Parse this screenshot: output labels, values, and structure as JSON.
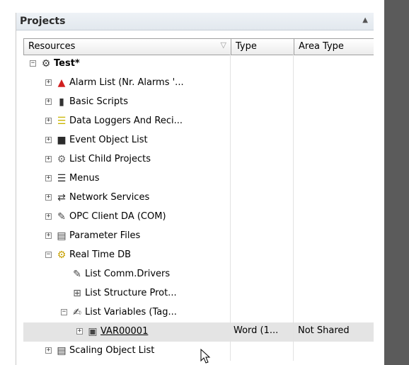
{
  "panel": {
    "title": "Projects"
  },
  "columns": {
    "resources": "Resources",
    "type": "Type",
    "area_type": "Area Type"
  },
  "tree": [
    {
      "label": "Test*",
      "expander": "−",
      "icon": "gear-icon",
      "glyph": "⚙",
      "color": "#3a3a3a",
      "type": "",
      "area": ""
    },
    {
      "label": "Alarm List (Nr. Alarms '...",
      "expander": "+",
      "icon": "alarm-bell-icon",
      "glyph": "▲",
      "color": "#d11f1f",
      "type": "",
      "area": ""
    },
    {
      "label": "Basic Scripts",
      "expander": "+",
      "icon": "script-icon",
      "glyph": "▮",
      "color": "#333333",
      "type": "",
      "area": ""
    },
    {
      "label": "Data Loggers And Reci...",
      "expander": "+",
      "icon": "database-icon",
      "glyph": "☰",
      "color": "#c9b400",
      "type": "",
      "area": ""
    },
    {
      "label": "Event Object List",
      "expander": "+",
      "icon": "event-icon",
      "glyph": "■",
      "color": "#2b2b2b",
      "type": "",
      "area": ""
    },
    {
      "label": "List Child Projects",
      "expander": "+",
      "icon": "child-projects-icon",
      "glyph": "⚙",
      "color": "#6a6a6a",
      "type": "",
      "area": ""
    },
    {
      "label": "Menus",
      "expander": "+",
      "icon": "menu-icon",
      "glyph": "☰",
      "color": "#2b2b2b",
      "type": "",
      "area": ""
    },
    {
      "label": "Network Services",
      "expander": "+",
      "icon": "network-icon",
      "glyph": "⇄",
      "color": "#333333",
      "type": "",
      "area": ""
    },
    {
      "label": "OPC Client DA (COM)",
      "expander": "+",
      "icon": "opc-icon",
      "glyph": "✎",
      "color": "#444444",
      "type": "",
      "area": ""
    },
    {
      "label": "Parameter Files",
      "expander": "+",
      "icon": "parameter-file-icon",
      "glyph": "▤",
      "color": "#444444",
      "type": "",
      "area": ""
    },
    {
      "label": "Real Time DB",
      "expander": "−",
      "icon": "realtime-db-icon",
      "glyph": "⚙",
      "color": "#c7a000",
      "type": "",
      "area": ""
    },
    {
      "label": "List Comm.Drivers",
      "expander": "",
      "icon": "comm-drivers-icon",
      "glyph": "✎",
      "color": "#444444",
      "type": "",
      "area": ""
    },
    {
      "label": "List Structure Prot...",
      "expander": "",
      "icon": "structure-icon",
      "glyph": "⊞",
      "color": "#555555",
      "type": "",
      "area": ""
    },
    {
      "label": "List Variables (Tag...",
      "expander": "−",
      "icon": "variables-icon",
      "glyph": "✍",
      "color": "#333333",
      "type": "",
      "area": ""
    },
    {
      "label": "VAR00001",
      "expander": "+",
      "icon": "variable-word-icon",
      "glyph": "▣",
      "color": "#444444",
      "type": "Word (1...",
      "area": "Not Shared"
    },
    {
      "label": "Scaling Object List",
      "expander": "+",
      "icon": "scaling-icon",
      "glyph": "▤",
      "color": "#333333",
      "type": "",
      "area": ""
    }
  ]
}
